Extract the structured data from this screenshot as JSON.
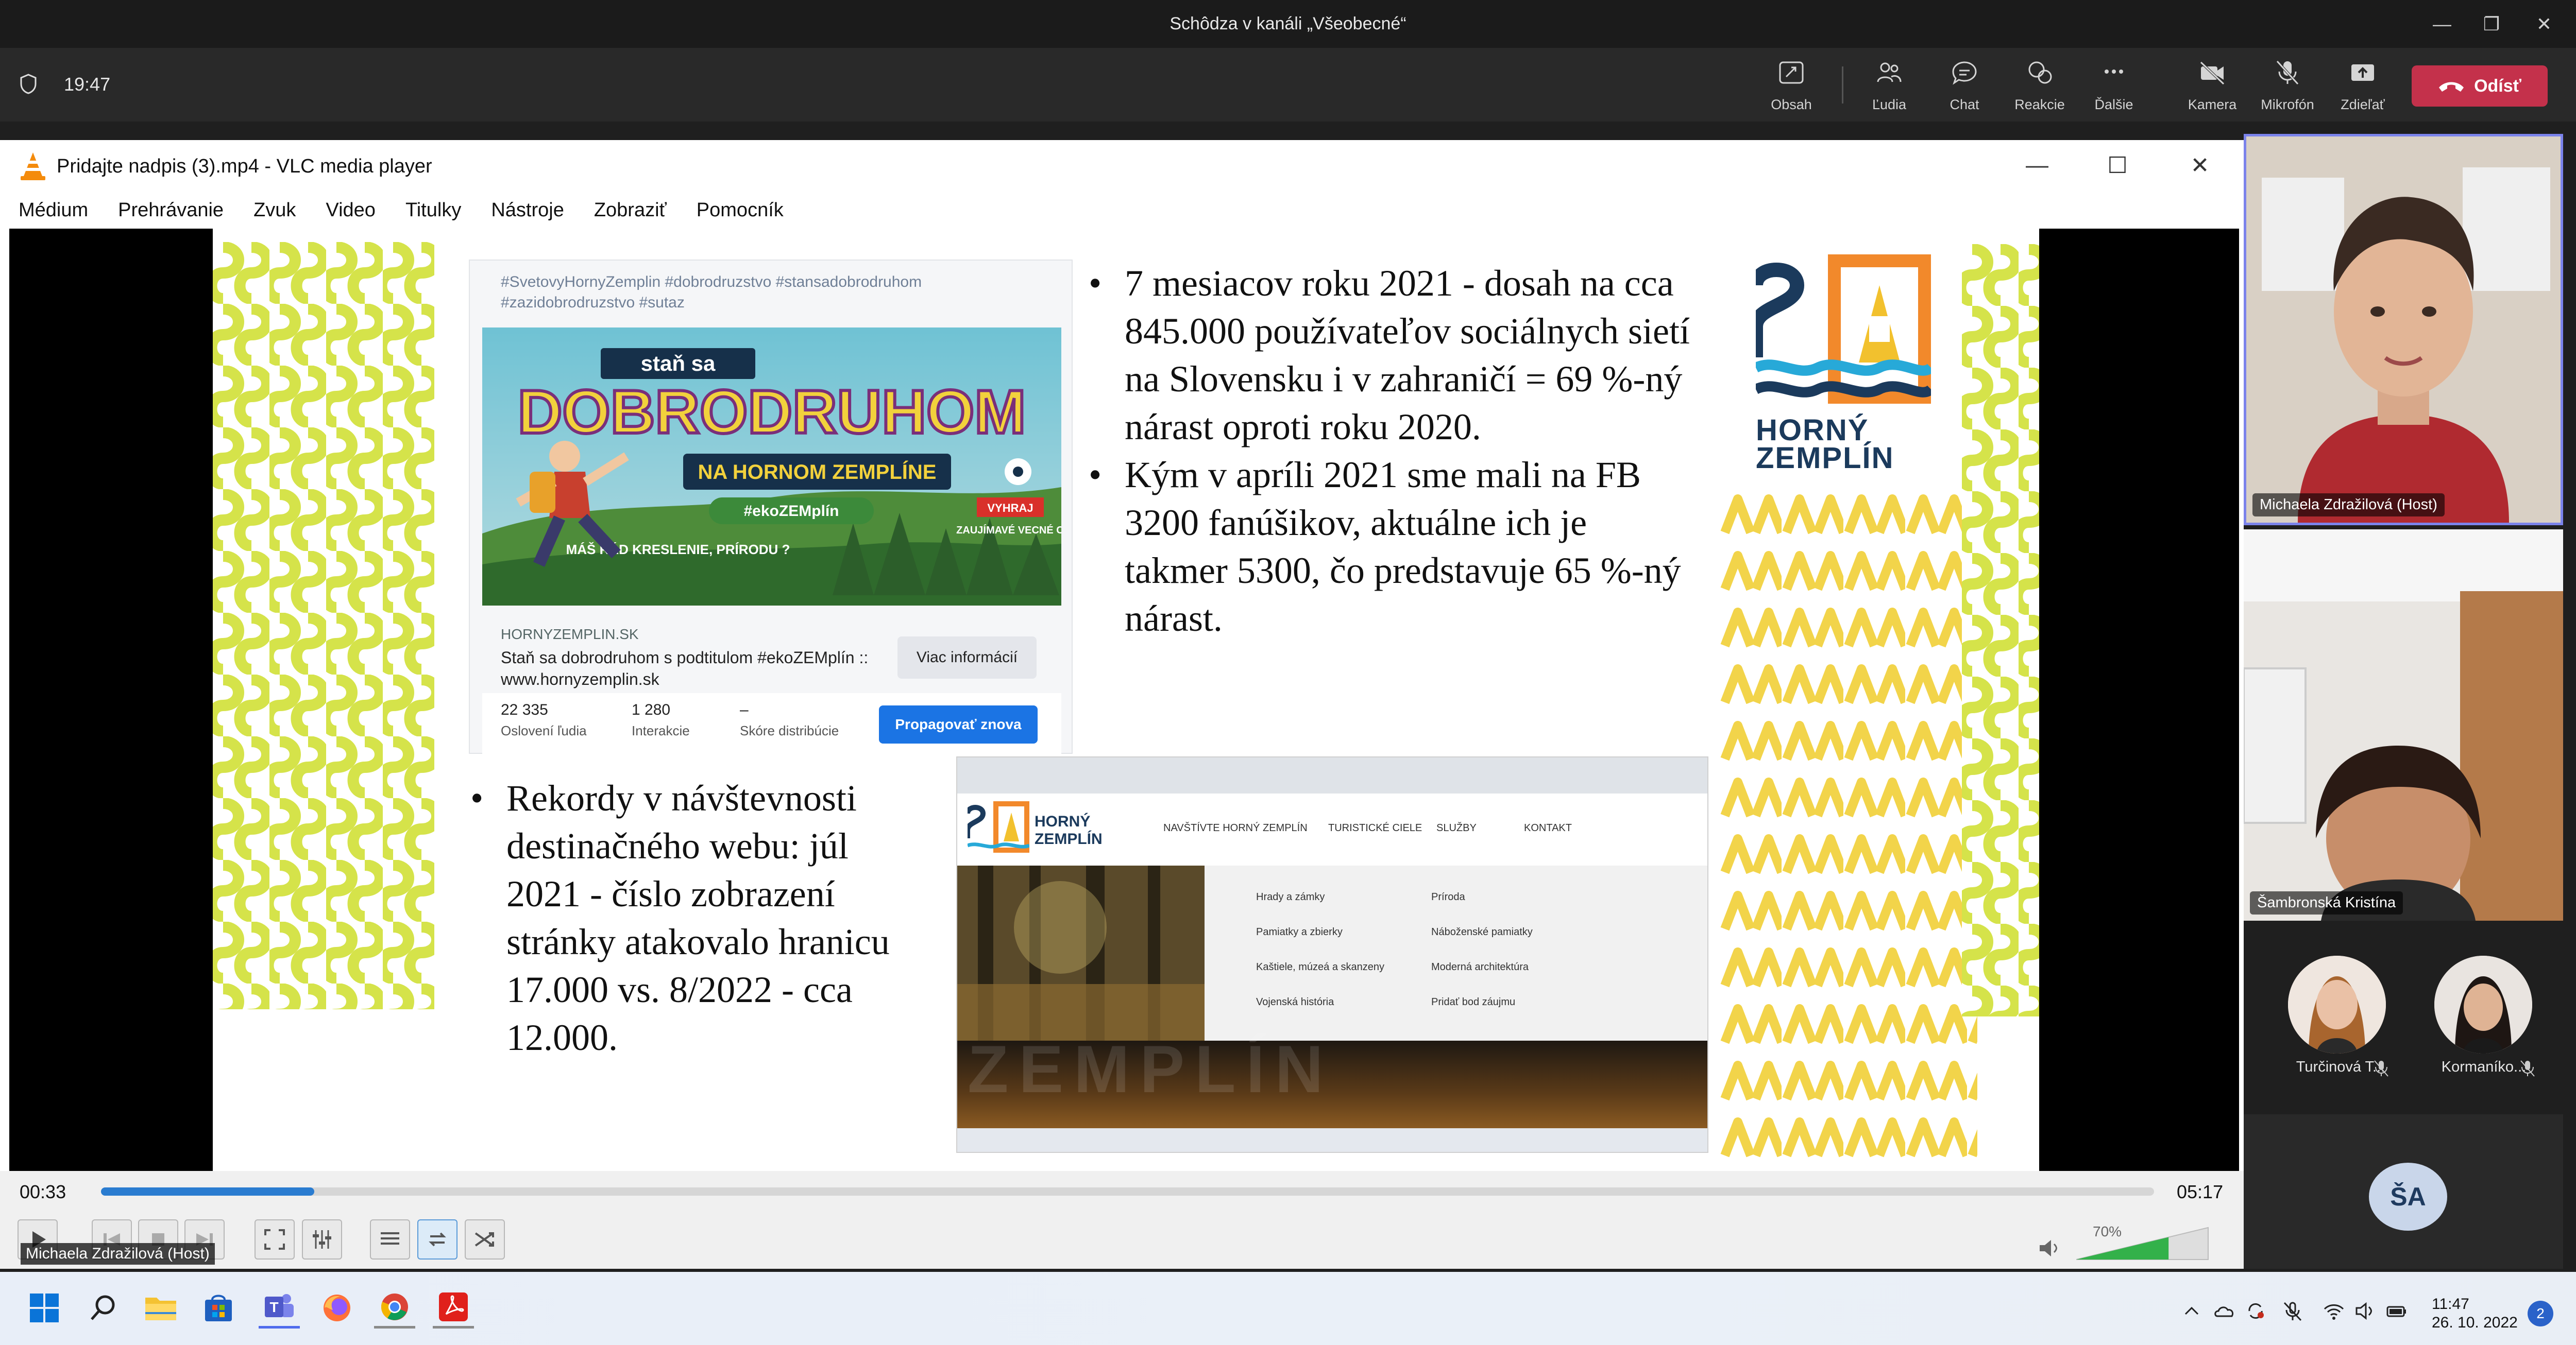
{
  "teams": {
    "window_title": "Schôdza v kanáli „Všeobecné“",
    "clock": "19:47",
    "buttons": [
      {
        "id": "content",
        "label": "Obsah",
        "icon": "content-icon"
      },
      {
        "id": "people",
        "label": "Ľudia",
        "icon": "people-icon"
      },
      {
        "id": "chat",
        "label": "Chat",
        "icon": "chat-icon"
      },
      {
        "id": "reactions",
        "label": "Reakcie",
        "icon": "reactions-icon"
      },
      {
        "id": "more",
        "label": "Ďalšie",
        "icon": "more-icon"
      },
      {
        "id": "camera",
        "label": "Kamera",
        "icon": "camera-off-icon"
      },
      {
        "id": "mic",
        "label": "Mikrofón",
        "icon": "mic-off-icon"
      },
      {
        "id": "share",
        "label": "Zdieľať",
        "icon": "share-icon"
      }
    ],
    "leave_label": "Odísť",
    "accent": "#c4314b"
  },
  "vlc": {
    "title": "Pridajte nadpis (3).mp4 - VLC media player",
    "menu": [
      "Médium",
      "Prehrávanie",
      "Zvuk",
      "Video",
      "Titulky",
      "Nástroje",
      "Zobraziť",
      "Pomocník"
    ],
    "time_current": "00:33",
    "time_total": "05:17",
    "progress_fraction": 0.104,
    "volume_percent": "70%",
    "volume_fraction": 0.7,
    "caption_overlay": "Michaela Zdražilová (Host)"
  },
  "slide": {
    "fb_post": {
      "tags": "#SvetovyHornyZemplin #dobrodruzstvo #stansadobrodruhom #zazidobrodruzstvo #sutaz",
      "image_title_top": "staň sa",
      "image_title_main": "DOBRODRUHOM",
      "image_subtitle": "NA HORNOM ZEMPLÍNE",
      "image_tag": "#ekoZEMplín",
      "image_question": "MÁŠ RÁD KRESLENIE, PRÍRODU ?",
      "image_prizes": "ZAUJÍMAVÉ VECNÉ CENY",
      "image_badge": "VYHRAJ",
      "domain": "HORNYZEMPLIN.SK",
      "description": "Staň sa dobrodruhom s podtitulom #ekoZEMplín :: www.hornyzemplin.sk",
      "more_button": "Viac informácií",
      "stats": [
        {
          "value": "22 335",
          "label": "Oslovení ľudia"
        },
        {
          "value": "1 280",
          "label": "Interakcie"
        },
        {
          "value": "–",
          "label": "Skóre distribúcie"
        }
      ],
      "promote_button": "Propagovať znova"
    },
    "bullets_right": [
      "7 mesiacov roku 2021 - dosah na cca 845.000 používateľov sociálnych sietí na Slovensku i v zahraničí = 69 %-ný nárast oproti roku 2020.",
      "Kým v apríli 2021 sme mali na FB 3200 fanúšikov, aktuálne ich je takmer 5300, čo predstavuje 65 %-ný nárast."
    ],
    "bullets_left": [
      "Rekordy v návštevnosti destinačného webu: júl 2021 - číslo zobrazení stránky atakovalo hranicu 17.000 vs. 8/2022 - cca 12.000."
    ],
    "logo_line1": "HORNÝ",
    "logo_line2": "ZEMPLÍN",
    "web": {
      "logo_line1": "HORNÝ",
      "logo_line2": "ZEMPLÍN",
      "nav": [
        "NAVŠTÍVTE HORNÝ ZEMPLÍN",
        "TURISTICKÉ CIELE",
        "SLUŽBY",
        "KONTAKT"
      ],
      "menu_left": [
        "Hrady a zámky",
        "Pamiatky a zbierky",
        "Kaštiele, múzeá a skanzeny",
        "Vojenská história"
      ],
      "menu_right": [
        "Príroda",
        "Náboženské pamiatky",
        "Moderná architektúra",
        "Pridať bod záujmu"
      ],
      "watermark": "ZEMPLÍN"
    }
  },
  "participants": {
    "main": "Michaela Zdražilová (Host)",
    "second": "Šambronská Kristína",
    "small": [
      {
        "name": "Turčinová T...",
        "muted": true
      },
      {
        "name": "Kormaníko...",
        "muted": true
      }
    ],
    "initials": "ŠA"
  },
  "taskbar": {
    "apps": [
      "windows-start-icon",
      "search-icon",
      "file-explorer-icon",
      "store-icon",
      "teams-icon",
      "firefox-icon",
      "chrome-icon",
      "acrobat-icon"
    ],
    "time": "11:47",
    "date": "26. 10. 2022",
    "notifications": "2"
  }
}
